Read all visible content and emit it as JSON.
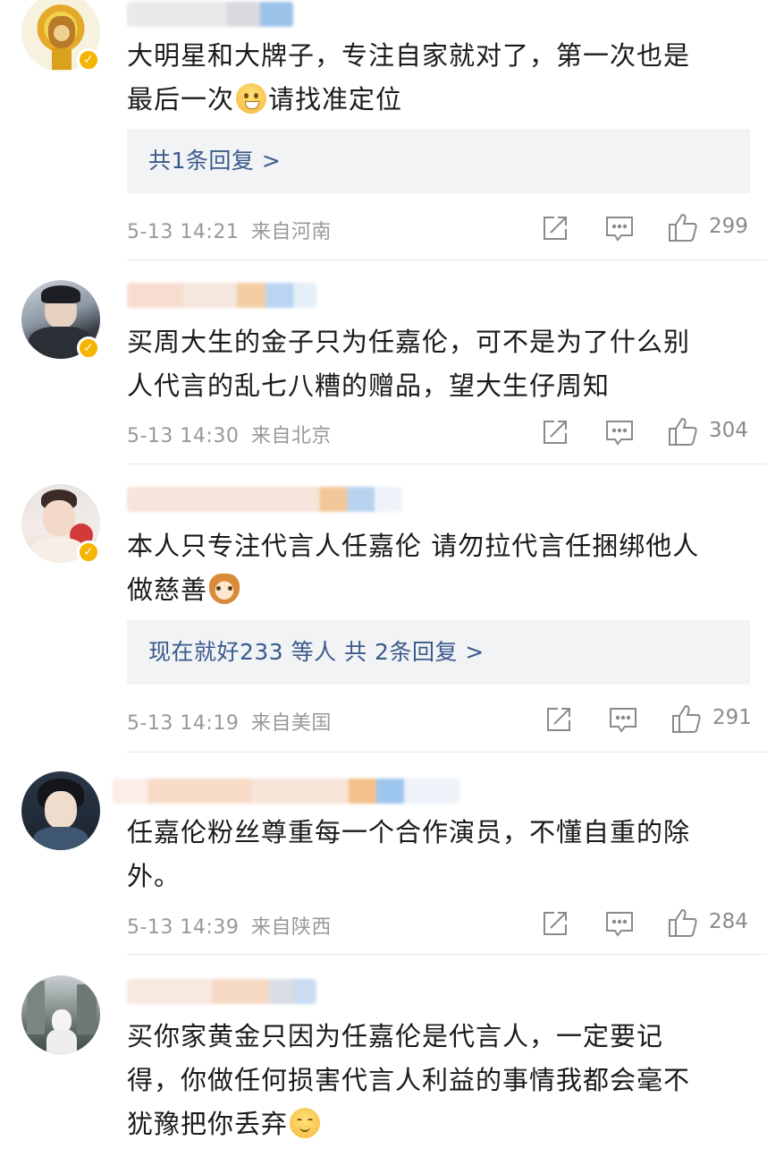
{
  "comments": [
    {
      "text_main": "大明星和大牌子，专注自家就对了，第一次也是",
      "text_line2_a": "最后一次",
      "text_line2_b": "请找准定位",
      "reply": "共1条回复 >",
      "time": "5-13 14:21",
      "location": "来自河南",
      "likes": "299"
    },
    {
      "text_main": "买周大生的金子只为任嘉伦，可不是为了什么别",
      "text_line2_a": "人代言的乱七八糟的赠品，望大生仔周知",
      "time": "5-13 14:30",
      "location": "来自北京",
      "likes": "304"
    },
    {
      "text_main": "本人只专注代言人任嘉伦 请勿拉代言任捆绑他人",
      "text_line2_a": "做慈善",
      "reply": "现在就好233 等人  共 2条回复 >",
      "time": "5-13 14:19",
      "location": "来自美国",
      "likes": "291"
    },
    {
      "text_main": "任嘉伦粉丝尊重每一个合作演员，不懂自重的除",
      "text_line2_a": "外。",
      "time": "5-13 14:39",
      "location": "来自陕西",
      "likes": "284"
    },
    {
      "text_main": "买你家黄金只因为任嘉伦是代言人，一定要记",
      "text_line2_a": "得，你做任何损害代言人利益的事情我都会毫不",
      "text_line3_a": "犹豫把你丢弃"
    }
  ],
  "icons": {
    "share": "share-icon",
    "comment": "comment-icon",
    "like": "thumbs-up-icon"
  },
  "colors": {
    "reply_link": "#3a5a8c",
    "verified_badge": "#f5b400",
    "meta_text": "#999999"
  }
}
